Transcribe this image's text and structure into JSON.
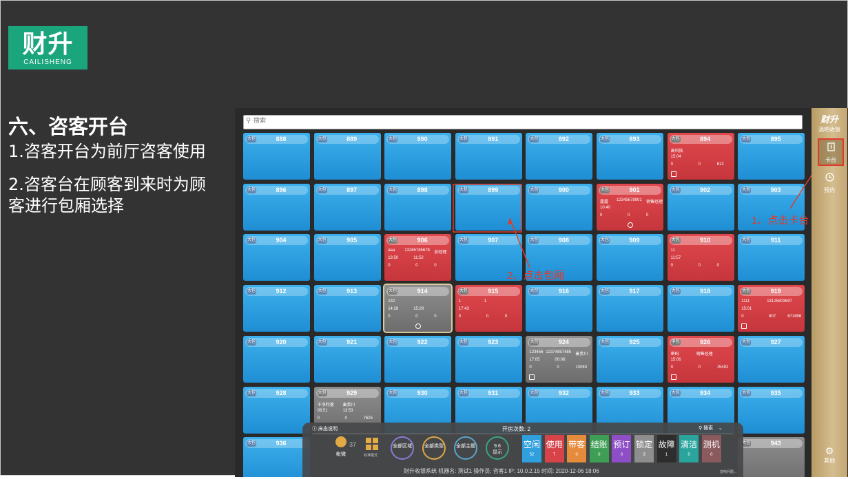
{
  "slide": {
    "logo_cn": "财升",
    "logo_en": "CAILISHENG",
    "heading": "六、咨客开台",
    "points": [
      "1.咨客开台为前厅咨客使用",
      "2.咨客台在顾客到来时为顾客进行包厢选择"
    ]
  },
  "app": {
    "search_placeholder": "搜索",
    "rooms": [
      {
        "num": "888",
        "tag": "大包",
        "state": "blue"
      },
      {
        "num": "889",
        "tag": "大包",
        "state": "blue"
      },
      {
        "num": "890",
        "tag": "大包",
        "state": "blue"
      },
      {
        "num": "891",
        "tag": "大包",
        "state": "blue"
      },
      {
        "num": "892",
        "tag": "大包",
        "state": "blue"
      },
      {
        "num": "893",
        "tag": "大包",
        "state": "blue"
      },
      {
        "num": "894",
        "tag": "大包",
        "state": "red",
        "lines": [
          [
            "高科技"
          ],
          [
            "15:04"
          ],
          [
            "0",
            "0",
            "613"
          ]
        ],
        "icon": "box"
      },
      {
        "num": "895",
        "tag": "大包",
        "state": "blue"
      },
      {
        "num": "896",
        "tag": "大包",
        "state": "blue"
      },
      {
        "num": "897",
        "tag": "大包",
        "state": "blue"
      },
      {
        "num": "898",
        "tag": "大包",
        "state": "blue"
      },
      {
        "num": "899",
        "tag": "大包",
        "state": "blue"
      },
      {
        "num": "900",
        "tag": "大包",
        "state": "blue"
      },
      {
        "num": "901",
        "tag": "大包",
        "state": "red",
        "lines": [
          [
            "露露",
            "12345678901",
            "销售经理"
          ],
          [
            "10:40"
          ],
          [
            "0",
            "0",
            "0"
          ]
        ],
        "icon": "bell"
      },
      {
        "num": "902",
        "tag": "大包",
        "state": "blue"
      },
      {
        "num": "903",
        "tag": "大包",
        "state": "blue"
      },
      {
        "num": "904",
        "tag": "大包",
        "state": "blue"
      },
      {
        "num": "905",
        "tag": "大包",
        "state": "blue"
      },
      {
        "num": "906",
        "tag": "大包",
        "state": "red",
        "lines": [
          [
            "aaa",
            "13265785678",
            "总经理"
          ],
          [
            "13:50",
            "11:52"
          ],
          [
            "0",
            "0",
            "0"
          ]
        ]
      },
      {
        "num": "907",
        "tag": "大包",
        "state": "blue"
      },
      {
        "num": "908",
        "tag": "大包",
        "state": "blue"
      },
      {
        "num": "909",
        "tag": "大包",
        "state": "blue"
      },
      {
        "num": "910",
        "tag": "大包",
        "state": "red",
        "lines": [
          [
            "11"
          ],
          [
            "11:57"
          ],
          [
            "0",
            "0",
            "0"
          ]
        ]
      },
      {
        "num": "911",
        "tag": "大包",
        "state": "blue"
      },
      {
        "num": "912",
        "tag": "大包",
        "state": "blue"
      },
      {
        "num": "913",
        "tag": "大包",
        "state": "blue"
      },
      {
        "num": "914",
        "tag": "大包",
        "state": "gray",
        "lines": [
          [
            "132"
          ],
          [
            "14:28",
            "15:29"
          ],
          [
            "0",
            "0",
            "0"
          ]
        ],
        "icon": "clock",
        "selected": true
      },
      {
        "num": "915",
        "tag": "大包",
        "state": "red",
        "lines": [
          [
            "1",
            "1"
          ],
          [
            "17:43"
          ],
          [
            "0",
            "0",
            "0"
          ]
        ]
      },
      {
        "num": "916",
        "tag": "大包",
        "state": "blue"
      },
      {
        "num": "917",
        "tag": "大包",
        "state": "blue"
      },
      {
        "num": "918",
        "tag": "大包",
        "state": "blue"
      },
      {
        "num": "919",
        "tag": "大包",
        "state": "red",
        "lines": [
          [
            "1111",
            "13125803697"
          ],
          [
            "15:01"
          ],
          [
            "0",
            "607",
            "671696"
          ]
        ],
        "icon": "box"
      },
      {
        "num": "920",
        "tag": "大包",
        "state": "blue"
      },
      {
        "num": "921",
        "tag": "大包",
        "state": "blue"
      },
      {
        "num": "922",
        "tag": "大包",
        "state": "blue"
      },
      {
        "num": "923",
        "tag": "大包",
        "state": "blue"
      },
      {
        "num": "924",
        "tag": "大包",
        "state": "gray",
        "lines": [
          [
            "123456",
            "12374857485",
            "秦贵川"
          ],
          [
            "17:05",
            "00:06"
          ],
          [
            "0",
            "0",
            "10080"
          ]
        ],
        "icon": "box"
      },
      {
        "num": "925",
        "tag": "大包",
        "state": "blue"
      },
      {
        "num": "926",
        "tag": "中包",
        "state": "red",
        "lines": [
          [
            "密码",
            "销售经理"
          ],
          [
            "15:06"
          ],
          [
            "0",
            "0",
            "15492"
          ]
        ],
        "icon": "box"
      },
      {
        "num": "927",
        "tag": "大包",
        "state": "blue"
      },
      {
        "num": "928",
        "tag": "大包",
        "state": "blue"
      },
      {
        "num": "929",
        "tag": "大包",
        "state": "gray",
        "lines": [
          [
            "干净利落",
            "秦贵川"
          ],
          [
            "09:51",
            "13:53"
          ],
          [
            "0",
            "0",
            "7625"
          ]
        ]
      },
      {
        "num": "930",
        "tag": "大包",
        "state": "blue"
      },
      {
        "num": "931",
        "tag": "大包",
        "state": "blue"
      },
      {
        "num": "932",
        "tag": "大包",
        "state": "blue"
      },
      {
        "num": "933",
        "tag": "大包",
        "state": "blue"
      },
      {
        "num": "934",
        "tag": "大包",
        "state": "blue"
      },
      {
        "num": "935",
        "tag": "大包",
        "state": "blue"
      },
      {
        "num": "936",
        "tag": "大包",
        "state": "blue"
      },
      {
        "num": "943",
        "tag": "大包",
        "state": "gray"
      }
    ],
    "bottom": {
      "legend_label": "床态说明",
      "open_count": "开房次数: 2",
      "search_label": "搜索",
      "user_label": "帐微",
      "user_count": "37",
      "mode_label": "标准模式",
      "circles": [
        {
          "label": "全部区域",
          "color": "#8b7bd6"
        },
        {
          "label": "全部类型",
          "color": "#e1aa45"
        },
        {
          "label": "全部主题",
          "color": "#5aa7cf"
        },
        {
          "label": "9.6\n显示",
          "color": "#3aa58a"
        }
      ],
      "statuses": [
        {
          "label": "空闲",
          "count": "52",
          "color": "#2f9fde"
        },
        {
          "label": "使用",
          "count": "7",
          "color": "#d8434a"
        },
        {
          "label": "带客",
          "count": "0",
          "color": "#e68a3c"
        },
        {
          "label": "结账",
          "count": "0",
          "color": "#3f9e56"
        },
        {
          "label": "预订",
          "count": "0",
          "color": "#8e4ec6"
        },
        {
          "label": "锁定",
          "count": "3",
          "color": "#8e8e8e"
        },
        {
          "label": "故障",
          "count": "1",
          "color": "#2d2d2d"
        },
        {
          "label": "清洁",
          "count": "0",
          "color": "#2aa59e"
        },
        {
          "label": "测机",
          "count": "0",
          "color": "#8a5a5e"
        }
      ],
      "footer": "财升收银系统      机器名: 测试1   操作员: 咨客1   IP: 10.0.2.15   时间: 2020-12-06 18:06",
      "footer_right": "音响问题..."
    },
    "side": {
      "brand": "财升",
      "sub": "酒吧收银",
      "btn_table": "卡台",
      "btn_reserve": "预约",
      "btn_other": "其他"
    },
    "annotations": {
      "click_card": "1、点击卡台",
      "click_room": "2、点击包厢"
    }
  },
  "colors": {
    "logo": "#1aa57c",
    "room_blue": "#2f9fde",
    "room_red": "#d8434a",
    "annotation": "#e03a2c",
    "side_panel": "#c9ae7a"
  }
}
